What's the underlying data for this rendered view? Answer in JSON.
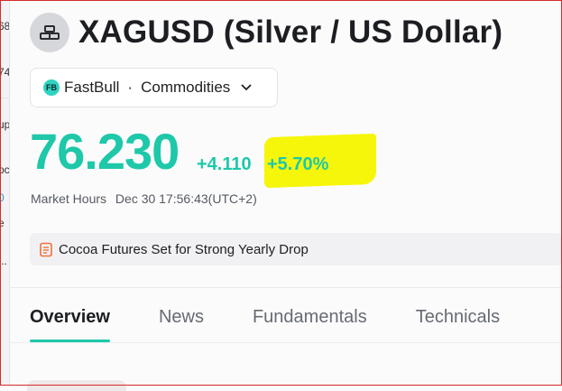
{
  "left_fragments": [
    "68",
    "74",
    "up",
    "pc",
    "0",
    "e",
    "..."
  ],
  "header": {
    "icon": "gold-bars-icon",
    "title": "XAGUSD (Silver / US Dollar)"
  },
  "source": {
    "badge": "FB",
    "provider": "FastBull",
    "separator": "·",
    "category": "Commodities"
  },
  "quote": {
    "price": "76.230",
    "change_abs": "+4.110",
    "change_pct": "+5.70%"
  },
  "market_status": {
    "label": "Market Hours",
    "datetime": "Dec 30 17:56:43(UTC+2)"
  },
  "news": {
    "icon": "document-icon",
    "headline": "Cocoa Futures Set for Strong Yearly Drop"
  },
  "tabs": [
    {
      "label": "Overview",
      "active": true
    },
    {
      "label": "News",
      "active": false
    },
    {
      "label": "Fundamentals",
      "active": false
    },
    {
      "label": "Technicals",
      "active": false
    }
  ],
  "colors": {
    "accent": "#1ec8a9",
    "highlight": "#f6f60a",
    "frame": "#d42a2a"
  }
}
